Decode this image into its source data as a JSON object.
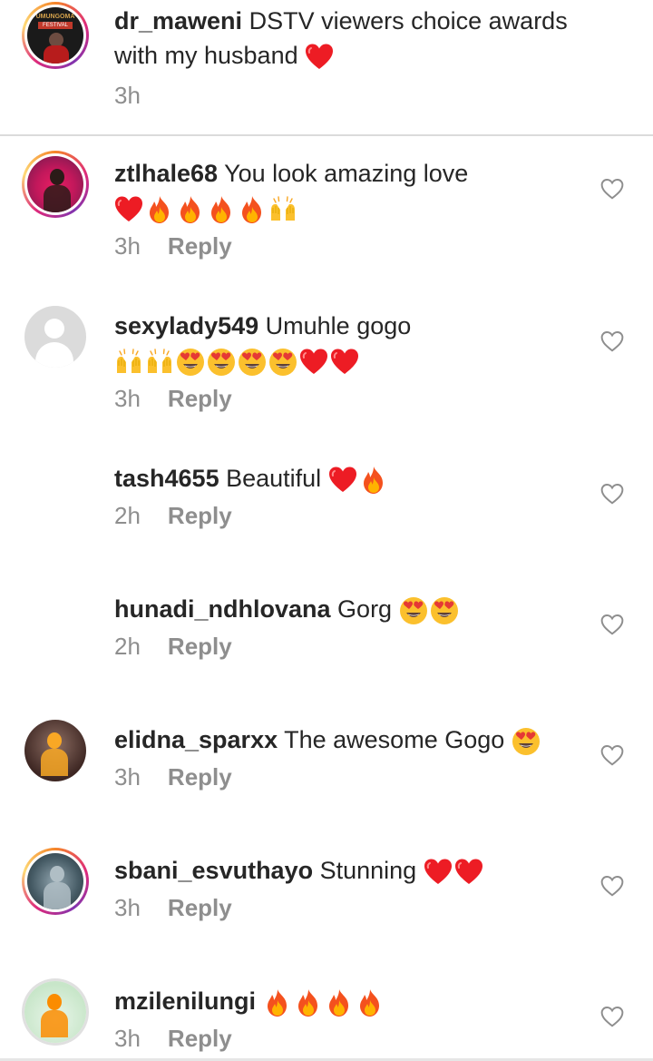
{
  "caption": {
    "username": "dr_maweni",
    "text": "DSTV viewers choice awards",
    "text_line2": "with my husband",
    "time": "3h",
    "avatar_badge": "UMUNGOMA",
    "avatar_banner": "FESTIVAL"
  },
  "reply_label": "Reply",
  "comments": [
    {
      "username": "ztlhale68",
      "text": "You look amazing love",
      "time": "3h",
      "emojis": [
        "red-heart",
        "fire",
        "fire",
        "fire",
        "fire",
        "raising-hands"
      ]
    },
    {
      "username": "sexylady549",
      "text": "Umuhle gogo",
      "time": "3h",
      "emojis": [
        "raising-hands",
        "raising-hands",
        "heart-eyes",
        "heart-eyes",
        "heart-eyes",
        "heart-eyes",
        "red-heart",
        "red-heart"
      ]
    },
    {
      "username": "tash4655",
      "text": "Beautiful",
      "time": "2h",
      "emojis": [
        "red-heart",
        "fire"
      ]
    },
    {
      "username": "hunadi_ndhlovana",
      "text": "Gorg",
      "time": "2h",
      "emojis": [
        "heart-eyes",
        "heart-eyes"
      ]
    },
    {
      "username": "elidna_sparxx",
      "text": "The awesome Gogo",
      "time": "3h",
      "emojis": [
        "heart-eyes"
      ]
    },
    {
      "username": "sbani_esvuthayo",
      "text": "Stunning",
      "time": "3h",
      "emojis": [
        "red-heart",
        "red-heart"
      ]
    },
    {
      "username": "mzilenilungi",
      "text": "",
      "time": "3h",
      "emojis": [
        "fire",
        "fire",
        "fire",
        "fire"
      ]
    }
  ],
  "colors": {
    "text": "#262626",
    "muted": "#8e8e8e",
    "divider": "#dbdbdb",
    "heart": "#ed1c24"
  }
}
